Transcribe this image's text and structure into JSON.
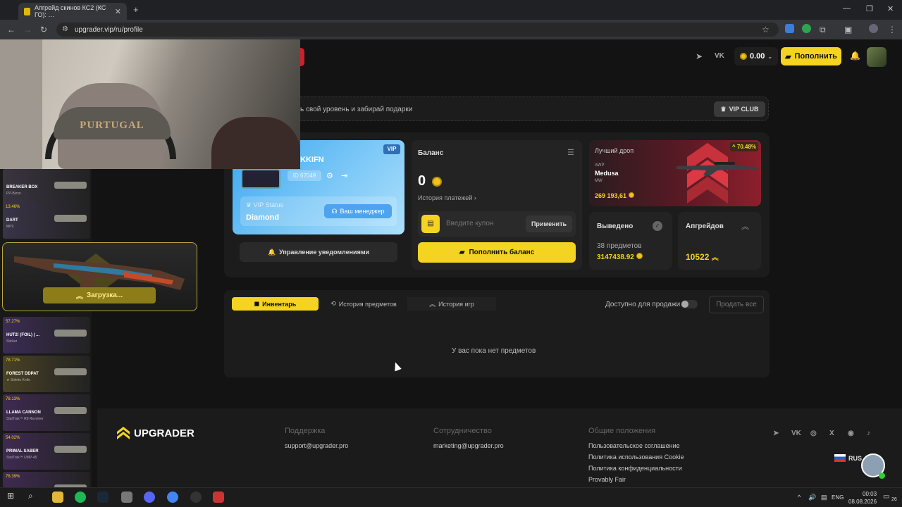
{
  "browser": {
    "tab_title": "Апгрейд скинов КС2 (КС ГО): …",
    "url": "upgrader.vip/ru/profile"
  },
  "webcam": {
    "cap_text": "PURTUGAL"
  },
  "header": {
    "social_vk": "VK",
    "balance": "0.00",
    "topup_label": "Пополнить"
  },
  "vip_strip": {
    "text": "ь свой уровень и забирай подарки",
    "club_label": "VIP CLUB"
  },
  "profile": {
    "vip_badge": "VIP",
    "username": "KKIFN",
    "user_id": "ID 67049",
    "vip_status_label": "VIP Status",
    "vip_status_value": "Diamond",
    "manager_label": "Ваш менеджер",
    "notifications_label": "Управление уведомлениями"
  },
  "balance": {
    "title": "Баланс",
    "value": "0",
    "history_label": "История платежей",
    "coupon_placeholder": "Введите купон",
    "apply_label": "Применить",
    "topup_label": "Пополнить баланс"
  },
  "best_drop": {
    "title": "Лучший дроп",
    "percent": "70.48%",
    "weapon_type": "AWP",
    "name": "Medusa",
    "condition": "MW",
    "price": "269 193,61"
  },
  "withdrawn": {
    "title": "Выведено",
    "items": "38 предметов",
    "sum": "3147438.92"
  },
  "upgrades": {
    "title": "Апгрейдов",
    "count": "10522"
  },
  "inventory": {
    "tabs": [
      "Инвентарь",
      "История предметов",
      "История игр"
    ],
    "sale_label": "Доступно для продажи",
    "sell_all_label": "Продать все",
    "empty_text": "У вас пока нет предметов"
  },
  "footer": {
    "logo_text": "UPGRADER",
    "col1_title": "Поддержка",
    "col1_link": "support@upgrader.pro",
    "col2_title": "Сотрудничество",
    "col2_link": "marketing@upgrader.pro",
    "col3_title": "Общие положения",
    "col3_links": [
      "Пользовательское соглашение",
      "Политика использования Cookie",
      "Политика конфиденциальности",
      "Provably Fair"
    ],
    "lang": "RUS",
    "social_vk": "VK",
    "social_x": "X"
  },
  "feed": [
    {
      "pct": "",
      "name": "BREAKER BOX",
      "sub": "PP-Bizon",
      "bg": "#3a3440"
    },
    {
      "pct": "13.46%",
      "name": "DART",
      "sub": "MP9",
      "bg": "#3a3448"
    },
    {
      "pct": "57.27%",
      "name": "HUT2! (FOIL) | ...",
      "sub": "Sticker",
      "bg": "#3b2c55"
    },
    {
      "pct": "78.71%",
      "name": "FOREST DDPAT",
      "sub": "★ Stiletto Knife",
      "bg": "#4a4224"
    },
    {
      "pct": "78.13%",
      "name": "LLAMA CANNON",
      "sub": "StatTrak™ R8 Revolver",
      "bg": "#3f2a52"
    },
    {
      "pct": "54.02%",
      "name": "PRIMAL SABER",
      "sub": "StatTrak™ UMP-45",
      "bg": "#3f2a52"
    },
    {
      "pct": "78.39%",
      "name": "",
      "sub": "",
      "bg": "#3f2a52"
    }
  ],
  "loading": {
    "label": "Загрузка..."
  },
  "taskbar": {
    "lang": "ENG",
    "time": "00:03",
    "date": "08.08.2026",
    "notif_count": "26"
  },
  "colors": {
    "accent": "#f5d321",
    "vip_blue": "#3aa7f0",
    "drop_red": "#8d1f2c"
  }
}
